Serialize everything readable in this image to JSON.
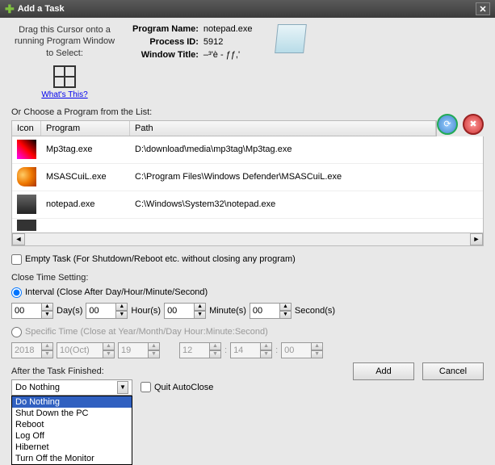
{
  "title": "Add a Task",
  "drag": {
    "text": "Drag this Cursor onto a running Program Window to Select:",
    "whats": "What's This?"
  },
  "info": {
    "programNameLabel": "Program Name:",
    "programName": "notepad.exe",
    "processIdLabel": "Process ID:",
    "processId": "5912",
    "windowTitleLabel": "Window Title:",
    "windowTitle": "–³'è - ƒƒ,'"
  },
  "listLabel": "Or Choose a Program from the List:",
  "cols": {
    "icon": "Icon",
    "program": "Program",
    "path": "Path"
  },
  "programs": [
    {
      "name": "Mp3tag.exe",
      "path": "D:\\download\\media\\mp3tag\\Mp3tag.exe"
    },
    {
      "name": "MSASCuiL.exe",
      "path": "C:\\Program Files\\Windows Defender\\MSASCuiL.exe"
    },
    {
      "name": "notepad.exe",
      "path": "C:\\Windows\\System32\\notepad.exe"
    }
  ],
  "emptyTask": "Empty Task (For Shutdown/Reboot etc. without closing any program)",
  "closeTimeLabel": "Close Time Setting:",
  "intervalLabel": "Interval (Close After Day/Hour/Minute/Second)",
  "interval": {
    "day": "00",
    "dayL": "Day(s)",
    "hour": "00",
    "hourL": "Hour(s)",
    "min": "00",
    "minL": "Minute(s)",
    "sec": "00",
    "secL": "Second(s)"
  },
  "specificLabel": "Specific Time (Close at Year/Month/Day Hour:Minute:Second)",
  "specific": {
    "year": "2018",
    "month": "10(Oct)",
    "day": "19",
    "hour": "12",
    "min": "14",
    "sec": "00"
  },
  "afterLabel": "After the Task Finished:",
  "comboValue": "Do Nothing",
  "options": [
    "Do Nothing",
    "Shut Down the PC",
    "Reboot",
    "Log Off",
    "Hibernet",
    "Turn Off the Monitor"
  ],
  "quitAC": "Quit AutoClose",
  "buttons": {
    "add": "Add",
    "cancel": "Cancel"
  }
}
